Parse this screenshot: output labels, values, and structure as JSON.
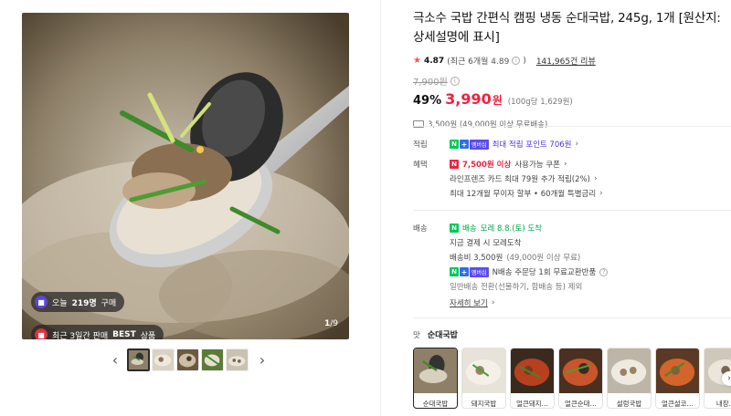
{
  "gallery": {
    "badge_today": {
      "prefix": "오늘",
      "count": "219명",
      "suffix": "구매"
    },
    "badge_best": {
      "text": "최근 3일간 판매",
      "highlight": "BEST",
      "suffix": "상품"
    },
    "counter": {
      "current": "1",
      "total": "/9"
    },
    "prev_icon": "chevron-left-icon",
    "next_icon": "chevron-right-icon"
  },
  "product": {
    "title": "극소수 국밥 간편식 캠핑 냉동 순대국밥, 245g, 1개 [원산지: 상세설명에 표시]",
    "rating": "4.87",
    "rating_recent": "(최근 6개월 4.89",
    "review_count": "141,965건 리뷰",
    "original_price": "7,900원",
    "discount": "49%",
    "price": "3,990",
    "won": "원",
    "unit_price": "(100g당 1,629원)",
    "shipping_note": "3,500원 (49,000원 이상 무료배송)"
  },
  "benefits": {
    "points_label": "적립",
    "points_text": "최대 적립 포인트 706원",
    "benefit_label": "혜택",
    "coupon_red": "7,500원 이상",
    "coupon_rest": "사용가능 쿠폰",
    "card_text": "라인프렌즈 카드 최대 79원 추가 적립(2%)",
    "installment_text": "최대 12개월 무이자 할부 • 60개월 특별금리"
  },
  "delivery": {
    "label": "배송",
    "arrival_prefix": "배송",
    "arrival": "모레 8.8.(토) 도착",
    "pay_now": "지금 결제 시 모레도착",
    "fee": "배송비 3,500원",
    "fee_note": "(49,000원 이상 무료)",
    "exchange": "N배송 주문당 1회 무료교환반품",
    "excluded": "일반배송 전환(선물하기, 합배송 등) 제외",
    "detail_link": "자세히 보기"
  },
  "taste": {
    "label": "맛",
    "selected": "순대국밥",
    "options": [
      "순대국밥",
      "돼지국밥",
      "얼큰돼지…",
      "얼큰순대…",
      "설렁국밥",
      "얼큰설코…",
      "내장…"
    ]
  },
  "colors": {
    "price_red": "#f2203e",
    "npay_green": "#03c75a",
    "point_purple": "#4b35e5"
  }
}
